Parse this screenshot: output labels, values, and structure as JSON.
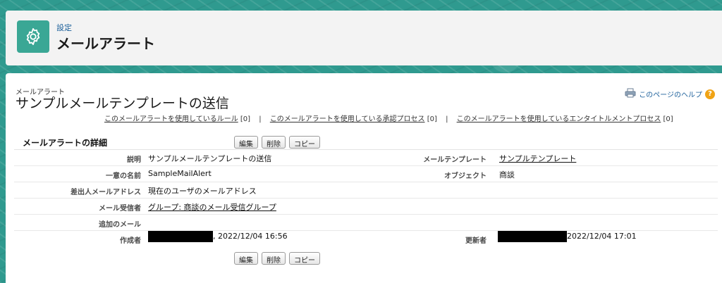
{
  "header": {
    "subtitle": "設定",
    "title": "メールアラート",
    "icon": "gear-icon"
  },
  "page": {
    "breadcrumb": "メールアラート",
    "title": "サンプルメールテンプレートの送信",
    "help_link": "このページのヘルプ",
    "help_badge": "?"
  },
  "related_links": [
    {
      "label": "このメールアラートを使用しているルール",
      "count": "[0]"
    },
    {
      "label": "このメールアラートを使用している承認プロセス",
      "count": "[0]"
    },
    {
      "label": "このメールアラートを使用しているエンタイトルメントプロセス",
      "count": "[0]"
    }
  ],
  "separator": "|",
  "detail": {
    "title": "メールアラートの詳細",
    "buttons": {
      "edit": "編集",
      "delete": "削除",
      "copy": "コピー"
    },
    "fields": {
      "description_label": "説明",
      "description_value": "サンプルメールテンプレートの送信",
      "template_label": "メールテンプレート",
      "template_value": "サンプルテンプレート",
      "unique_name_label": "一意の名前",
      "unique_name_value": "SampleMailAlert",
      "object_label": "オブジェクト",
      "object_value": "商談",
      "from_label": "差出人メールアドレス",
      "from_value": "現在のユーザのメールアドレス",
      "recipients_label": "メール受信者",
      "recipients_value": "グループ: 商談のメール受信グループ",
      "additional_label": "追加のメール",
      "additional_value": "",
      "created_label": "作成者",
      "created_value": ", 2022/12/04 16:56",
      "modified_label": "更新者",
      "modified_value": "2022/12/04 17:01"
    }
  }
}
